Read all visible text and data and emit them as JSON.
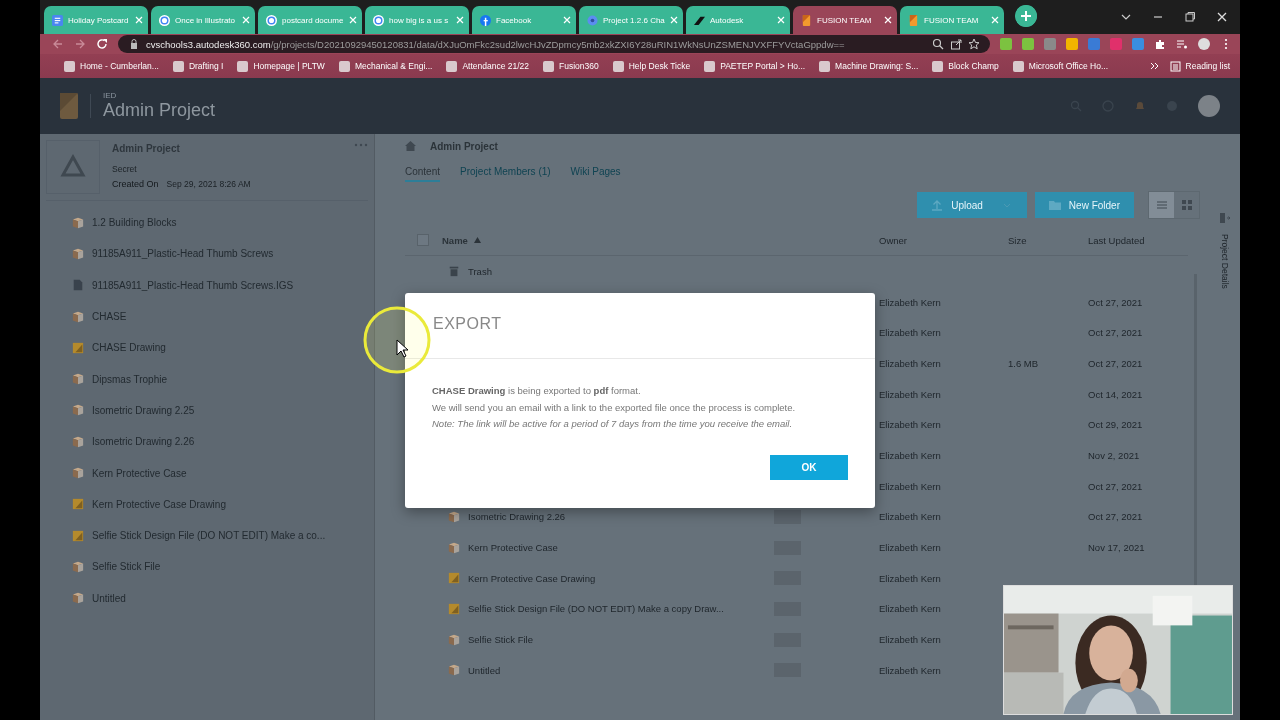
{
  "browser": {
    "tabs": [
      {
        "title": "Holiday Postcard",
        "kind": "docs",
        "selected": false
      },
      {
        "title": "Once in Illustrato",
        "kind": "google",
        "selected": false
      },
      {
        "title": "postcard docume",
        "kind": "google",
        "selected": false
      },
      {
        "title": "how big is a us s",
        "kind": "google",
        "selected": false
      },
      {
        "title": "Facebook",
        "kind": "facebook",
        "selected": false
      },
      {
        "title": "Project 1.2.6 Cha",
        "kind": "gear",
        "selected": false
      },
      {
        "title": "Autodesk",
        "kind": "autodesk",
        "selected": false
      },
      {
        "title": "FUSION TEAM",
        "kind": "fusion",
        "selected": true
      },
      {
        "title": "FUSION TEAM",
        "kind": "fusion",
        "selected": false
      }
    ],
    "url_host": "cvschools3.autodesk360.com",
    "url_path": "/g/projects/D20210929450120831/data/dXJuOmFkc2sud2lwcHJvZDpmcy5mb2xkZXI6Y28uRIN1WkNsUnZSMENJVXFFYVctaGppdw==",
    "bookmarks": [
      {
        "label": "Home - Cumberlan..."
      },
      {
        "label": "Drafting I"
      },
      {
        "label": "Homepage | PLTW"
      },
      {
        "label": "Mechanical & Engi..."
      },
      {
        "label": "Attendance 21/22"
      },
      {
        "label": "Fusion360"
      },
      {
        "label": "Help Desk Ticke"
      },
      {
        "label": "PAETEP Portal > Ho..."
      },
      {
        "label": "Machine Drawing: S..."
      },
      {
        "label": "Block Champ"
      },
      {
        "label": "Microsoft Office Ho..."
      }
    ],
    "reading_list": "Reading list"
  },
  "app": {
    "header": {
      "hub": "IED",
      "title": "Admin Project"
    },
    "sidebar": {
      "project": {
        "name": "Admin Project",
        "visibility": "Secret",
        "created_label": "Created On",
        "created": "Sep 29, 2021 8:26 AM"
      },
      "items": [
        {
          "name": "1.2 Building Blocks",
          "kind": "design"
        },
        {
          "name": "91185A911_Plastic-Head Thumb Screws",
          "kind": "design"
        },
        {
          "name": "91185A911_Plastic-Head Thumb Screws.IGS",
          "kind": "file"
        },
        {
          "name": "CHASE",
          "kind": "design"
        },
        {
          "name": "CHASE Drawing",
          "kind": "drawing"
        },
        {
          "name": "Dipsmas Trophie",
          "kind": "design"
        },
        {
          "name": "Isometric Drawing 2.25",
          "kind": "design"
        },
        {
          "name": "Isometric Drawing 2.26",
          "kind": "design"
        },
        {
          "name": "Kern Protective Case",
          "kind": "design"
        },
        {
          "name": "Kern Protective Case Drawing",
          "kind": "drawing"
        },
        {
          "name": "Selfie Stick Design File (DO NOT EDIT) Make a co...",
          "kind": "drawing"
        },
        {
          "name": "Selfie Stick File",
          "kind": "design"
        },
        {
          "name": "Untitled",
          "kind": "design"
        }
      ]
    },
    "breadcrumb": "Admin Project",
    "tabs": [
      {
        "label": "Content",
        "selected": true
      },
      {
        "label": "Project Members (1)",
        "selected": false
      },
      {
        "label": "Wiki Pages",
        "selected": false
      }
    ],
    "buttons": {
      "upload": "Upload",
      "new_folder": "New Folder"
    },
    "view": {
      "list_selected": true
    },
    "side_panel": "Project Details",
    "table": {
      "select_all_checked": false,
      "columns": [
        {
          "label": "Name"
        },
        {
          "label": "Owner"
        },
        {
          "label": "Size"
        },
        {
          "label": "Last Updated"
        }
      ],
      "rows": [
        {
          "name": "Trash",
          "kind": "trash"
        },
        {
          "owner": "Elizabeth Kern",
          "updated": "Oct 27, 2021"
        },
        {
          "owner": "Elizabeth Kern",
          "updated": "Oct 27, 2021"
        },
        {
          "owner": "Elizabeth Kern",
          "size": "1.6 MB",
          "updated": "Oct 27, 2021"
        },
        {
          "owner": "Elizabeth Kern",
          "updated": "Oct 14, 2021"
        },
        {
          "owner": "Elizabeth Kern",
          "updated": "Oct 29, 2021"
        },
        {
          "owner": "Elizabeth Kern",
          "updated": "Nov 2, 2021"
        },
        {
          "owner": "Elizabeth Kern",
          "updated": "Oct 27, 2021"
        },
        {
          "name": "Isometric Drawing 2.26",
          "kind": "design",
          "owner": "Elizabeth Kern",
          "updated": "Oct 27, 2021"
        },
        {
          "name": "Kern Protective Case",
          "kind": "design",
          "owner": "Elizabeth Kern",
          "updated": "Nov 17, 2021"
        },
        {
          "name": "Kern Protective Case Drawing",
          "kind": "drawing",
          "owner": "Elizabeth Kern"
        },
        {
          "name": "Selfie Stick Design File (DO NOT EDIT) Make a copy Draw...",
          "kind": "drawing",
          "owner": "Elizabeth Kern"
        },
        {
          "name": "Selfie Stick File",
          "kind": "design",
          "owner": "Elizabeth Kern"
        },
        {
          "name": "Untitled",
          "kind": "design",
          "owner": "Elizabeth Kern"
        }
      ]
    }
  },
  "dialog": {
    "title": "EXPORT",
    "message": "**CHASE Drawing** is being exported to **pdf** format.",
    "detail": "We will send you an email with a link to the exported file once the process is complete.",
    "note": "Note: The link will be active for a period of 7 days from the time you receive the email.",
    "button": "OK"
  }
}
